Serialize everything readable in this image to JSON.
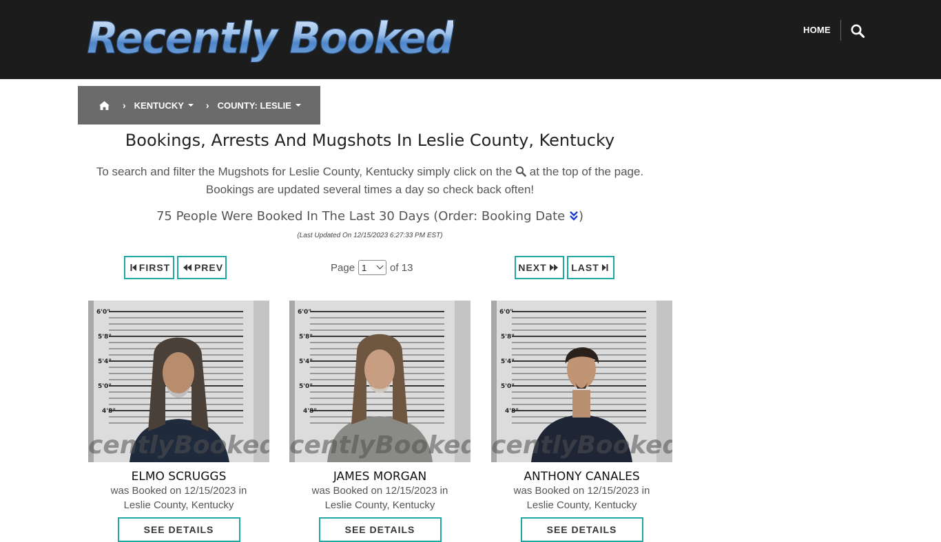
{
  "header": {
    "logo_text": "Recently Booked",
    "nav_home": "HOME",
    "search_icon": "search-icon"
  },
  "breadcrumb": {
    "home_icon": "home-icon",
    "state": "KENTUCKY",
    "county": "COUNTY: LESLIE"
  },
  "main": {
    "title": "Bookings, Arrests And Mugshots In Leslie County, Kentucky",
    "intro_before_icon": "To search and filter the Mugshots for Leslie County, Kentucky simply click on the",
    "intro_after_icon": "at the top of the page.",
    "intro_line2": "Bookings are updated several times a day so check back often!",
    "count_text": "75 People Were Booked In The Last 30 Days (Order: Booking Date",
    "count_close": ")",
    "last_updated": "(Last Updated On 12/15/2023 6:27:33 PM EST)"
  },
  "pagination": {
    "first": "FIRST",
    "prev": "PREV",
    "next": "NEXT",
    "last": "LAST",
    "page_label": "Page",
    "current_page": "1",
    "of_label": "of 13"
  },
  "bookings": [
    {
      "name": "ELMO SCRUGGS",
      "booked_line": "was Booked on 12/15/2023 in",
      "location": "Leslie County, Kentucky",
      "details_label": "SEE DETAILS",
      "watermark": "centlyBooked.co"
    },
    {
      "name": "JAMES MORGAN",
      "booked_line": "was Booked on 12/15/2023 in",
      "location": "Leslie County, Kentucky",
      "details_label": "SEE DETAILS",
      "watermark": "centlyBooked.co"
    },
    {
      "name": "ANTHONY CANALES",
      "booked_line": "was Booked on 12/15/2023 in",
      "location": "Leslie County, Kentucky",
      "details_label": "SEE DETAILS",
      "watermark": "centlyBooked.co"
    }
  ],
  "height_chart_labels": [
    "6'0\"",
    "5'8\"",
    "5'4\"",
    "5'0\"",
    "4'8\""
  ],
  "colors": {
    "topbar": "#1c1c1c",
    "breadcrumb": "#6b6b6b",
    "button_border": "#1fa8a3"
  }
}
